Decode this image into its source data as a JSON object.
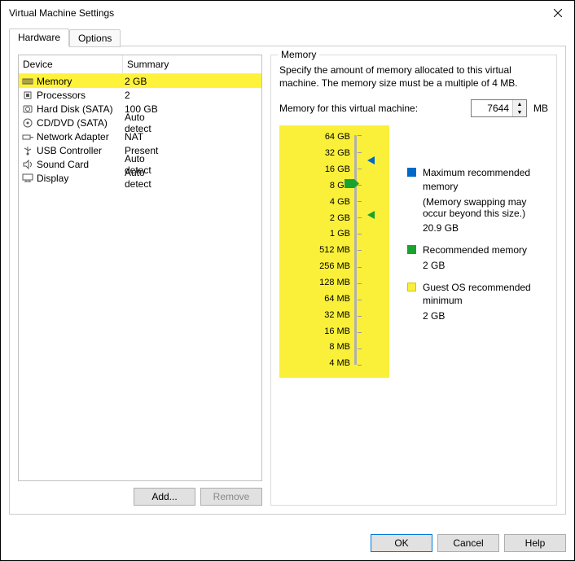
{
  "window_title": "Virtual Machine Settings",
  "tabs": {
    "hardware": "Hardware",
    "options": "Options"
  },
  "device_headers": {
    "device": "Device",
    "summary": "Summary"
  },
  "devices": [
    {
      "icon": "memory",
      "name": "Memory",
      "summary": "2 GB",
      "hl": true
    },
    {
      "icon": "cpu",
      "name": "Processors",
      "summary": "2"
    },
    {
      "icon": "hdd",
      "name": "Hard Disk (SATA)",
      "summary": "100 GB"
    },
    {
      "icon": "cd",
      "name": "CD/DVD (SATA)",
      "summary": "Auto detect"
    },
    {
      "icon": "net",
      "name": "Network Adapter",
      "summary": "NAT"
    },
    {
      "icon": "usb",
      "name": "USB Controller",
      "summary": "Present"
    },
    {
      "icon": "sound",
      "name": "Sound Card",
      "summary": "Auto detect"
    },
    {
      "icon": "display",
      "name": "Display",
      "summary": "Auto detect"
    }
  ],
  "add_label": "Add...",
  "remove_label": "Remove",
  "memory": {
    "legend": "Memory",
    "desc": "Specify the amount of memory allocated to this virtual machine. The memory size must be a multiple of 4 MB.",
    "label": "Memory for this virtual machine:",
    "value": "7644",
    "unit": "MB",
    "scale": [
      "64 GB",
      "32 GB",
      "16 GB",
      "8 GB",
      "4 GB",
      "2 GB",
      "1 GB",
      "512 MB",
      "256 MB",
      "128 MB",
      "64 MB",
      "32 MB",
      "16 MB",
      "8 MB",
      "4 MB"
    ],
    "max_label": "Maximum recommended memory",
    "max_note": "(Memory swapping may occur beyond this size.)",
    "max_value": "20.9 GB",
    "rec_label": "Recommended memory",
    "rec_value": "2 GB",
    "min_label": "Guest OS recommended minimum",
    "min_value": "2 GB",
    "colors": {
      "max": "#0068c6",
      "rec": "#19a22e",
      "min": "#faf03a",
      "thumb": "#19a22e"
    }
  },
  "footer": {
    "ok": "OK",
    "cancel": "Cancel",
    "help": "Help"
  }
}
